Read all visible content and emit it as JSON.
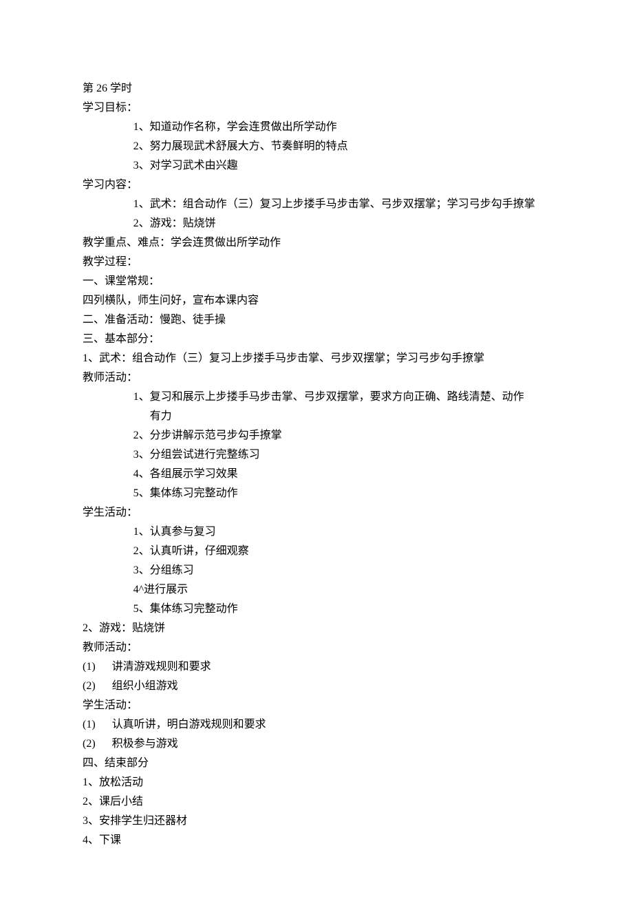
{
  "header": {
    "lesson": "第 26 学时",
    "goals_label": "学习目标：",
    "goals": [
      "1、知道动作名称，学会连贯做出所学动作",
      "2、努力展现武术舒展大方、节奏鲜明的特点",
      "3、对学习武术由兴趣"
    ],
    "content_label": "学习内容：",
    "contents": [
      "1、武术：组合动作（三）复习上步搂手马步击掌、弓步双摆掌；学习弓步勾手撩掌",
      "2、游戏：贴烧饼"
    ],
    "keypoint": "教学重点、难点：学会连贯做出所学动作",
    "process_label": "教学过程："
  },
  "section1": {
    "title": "一、课堂常规：",
    "line": "四列横队，师生问好，宣布本课内容"
  },
  "section2": {
    "title": "二、准备活动：慢跑、徒手操"
  },
  "section3": {
    "title": "三、基本部分：",
    "item1_title": "1、武术：组合动作（三）复习上步搂手马步击掌、弓步双摆掌；学习弓步勾手撩掌",
    "teacher_label": "教师活动：",
    "teacher_acts": [
      "1、复习和展示上步搂手马步击掌、弓步双摆掌，要求方向正确、路线清楚、动作",
      "有力",
      "2、分步讲解示范弓步勾手撩掌",
      "3、分组尝试进行完整练习",
      "4、各组展示学习效果",
      "5、集体练习完整动作"
    ],
    "student_label": "学生活动：",
    "student_acts": [
      "1、认真参与复习",
      "2、认真听讲，仔细观察",
      "3、分组练习",
      "4^进行展示",
      "5、集体练习完整动作"
    ],
    "item2_title": "2、游戏：贴烧饼",
    "teacher_label2": "教师活动：",
    "teacher_acts2": [
      "(1)      讲清游戏规则和要求",
      "(2)      组织小组游戏"
    ],
    "student_label2": "学生活动：",
    "student_acts2": [
      "(1)      认真听讲，明白游戏规则和要求",
      "(2)      积极参与游戏"
    ]
  },
  "section4": {
    "title": "四、结束部分",
    "items": [
      "1、放松活动",
      "2、课后小结",
      "3、安排学生归还器材",
      "4、下课"
    ]
  }
}
